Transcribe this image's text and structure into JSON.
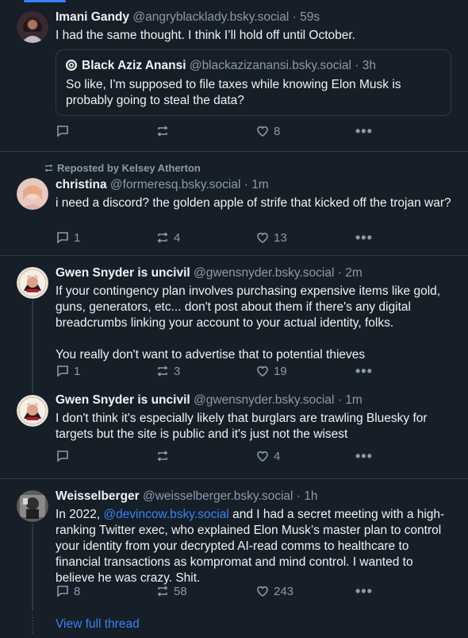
{
  "posts": [
    {
      "name": "Imani Gandy",
      "handle": "@angryblacklady.bsky.social",
      "time": "59s",
      "text": "I had the same thought. I think I’ll hold off until October.",
      "quote": {
        "name": "Black Aziz Anansi",
        "handle": "@blackazizanansi.bsky.social",
        "time": "3h",
        "text": "So like, I'm supposed to file taxes while knowing Elon Musk is probably going to steal the data?"
      },
      "replies": "",
      "reposts": "",
      "likes": "8"
    },
    {
      "repost_label": "Reposted by Kelsey Atherton",
      "name": "christina",
      "handle": "@formeresq.bsky.social",
      "time": "1m",
      "text": "i need a discord? the golden apple of strife that kicked off the trojan war?",
      "replies": "1",
      "reposts": "4",
      "likes": "13"
    },
    {
      "name": "Gwen Snyder is uncivil",
      "handle": "@gwensnyder.bsky.social",
      "time": "2m",
      "text1": "If your contingency plan involves purchasing expensive items like gold, guns, generators, etc... don't post about them if there's any digital breadcrumbs linking your account to your actual identity, folks.",
      "text2": "You really don't want to advertise that to potential thieves",
      "replies": "1",
      "reposts": "3",
      "likes": "19"
    },
    {
      "name": "Gwen Snyder is uncivil",
      "handle": "@gwensnyder.bsky.social",
      "time": "1m",
      "text": "I don't think it's especially likely that burglars are trawling Bluesky for targets but the site is public and it's just not the wisest",
      "replies": "",
      "reposts": "",
      "likes": "4"
    },
    {
      "name": "Weisselberger",
      "handle": "@weisselberger.bsky.social",
      "time": "1h",
      "text_pre": "In 2022, ",
      "mention": "@devincow.bsky.social",
      "text_post": " and I had a secret meeting with a high-ranking Twitter exec, who explained Elon Musk’s master plan to control your identity from your decrypted AI-read comms to healthcare to financial transactions as kompromat and mind control. I wanted to believe he was crazy. Shit.",
      "replies": "8",
      "reposts": "58",
      "likes": "243"
    }
  ],
  "view_full_thread": "View full thread",
  "separator": "·",
  "more_glyph": "•••",
  "colors": {
    "accent": "#3b82f6",
    "background": "#161e27",
    "muted": "#8d9aab"
  }
}
